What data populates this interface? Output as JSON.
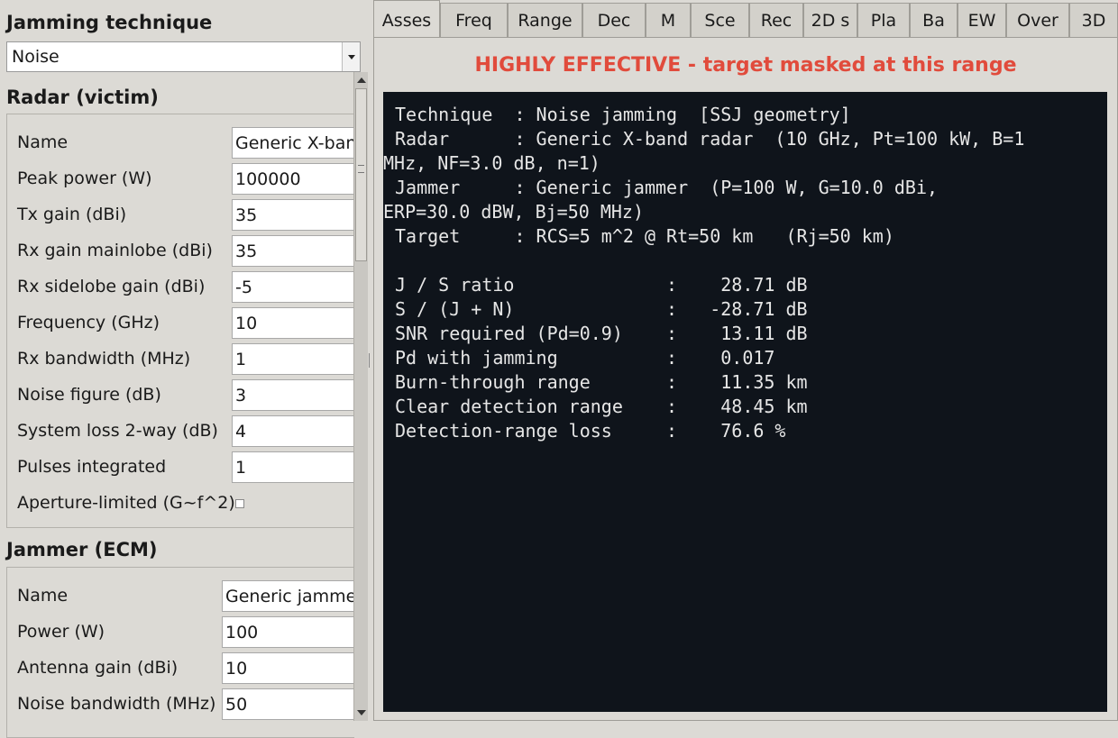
{
  "jamming": {
    "title": "Jamming technique",
    "selected": "Noise"
  },
  "radar": {
    "title": "Radar (victim)",
    "fields": [
      {
        "label": "Name",
        "value": "Generic X-band"
      },
      {
        "label": "Peak power (W)",
        "value": "100000"
      },
      {
        "label": "Tx gain (dBi)",
        "value": "35"
      },
      {
        "label": "Rx gain mainlobe (dBi)",
        "value": "35"
      },
      {
        "label": "Rx sidelobe gain (dBi)",
        "value": "-5"
      },
      {
        "label": "Frequency (GHz)",
        "value": "10"
      },
      {
        "label": "Rx bandwidth (MHz)",
        "value": "1"
      },
      {
        "label": "Noise figure (dB)",
        "value": "3"
      },
      {
        "label": "System loss 2-way (dB)",
        "value": "4"
      },
      {
        "label": "Pulses integrated",
        "value": "1"
      }
    ],
    "aperture_label": "Aperture-limited (G~f^2)",
    "aperture_checked": false
  },
  "jammer": {
    "title": "Jammer (ECM)",
    "fields": [
      {
        "label": "Name",
        "value": "Generic jammer"
      },
      {
        "label": "Power (W)",
        "value": "100"
      },
      {
        "label": "Antenna gain (dBi)",
        "value": "10"
      },
      {
        "label": "Noise bandwidth (MHz)",
        "value": "50"
      }
    ]
  },
  "tabs": [
    {
      "label": "Asses",
      "active": true
    },
    {
      "label": "Freq"
    },
    {
      "label": "Range"
    },
    {
      "label": "Dec"
    },
    {
      "label": "M"
    },
    {
      "label": "Sce"
    },
    {
      "label": "Rec"
    },
    {
      "label": "2D s"
    },
    {
      "label": "Pla"
    },
    {
      "label": "Ba"
    },
    {
      "label": "EW"
    },
    {
      "label": "Over"
    },
    {
      "label": "3D"
    }
  ],
  "assessment": {
    "verdict": "HIGHLY EFFECTIVE - target masked at this range",
    "verdict_color": "#e14b3c",
    "lines": [
      "Technique  : Noise jamming  [SSJ geometry]",
      "Radar      : Generic X-band radar  (10 GHz, Pt=100 kW, B=1",
      "MHz, NF=3.0 dB, n=1)",
      "Jammer     : Generic jammer  (P=100 W, G=10.0 dBi,",
      "ERP=30.0 dBW, Bj=50 MHz)",
      "Target     : RCS=5 m^2 @ Rt=50 km   (Rj=50 km)",
      "",
      "J / S ratio              :    28.71 dB",
      "S / (J + N)              :   -28.71 dB",
      "SNR required (Pd=0.9)    :    13.11 dB",
      "Pd with jamming          :    0.017",
      "Burn-through range       :    11.35 km",
      "Clear detection range    :    48.45 km",
      "Detection-range loss     :    76.6 %"
    ]
  }
}
